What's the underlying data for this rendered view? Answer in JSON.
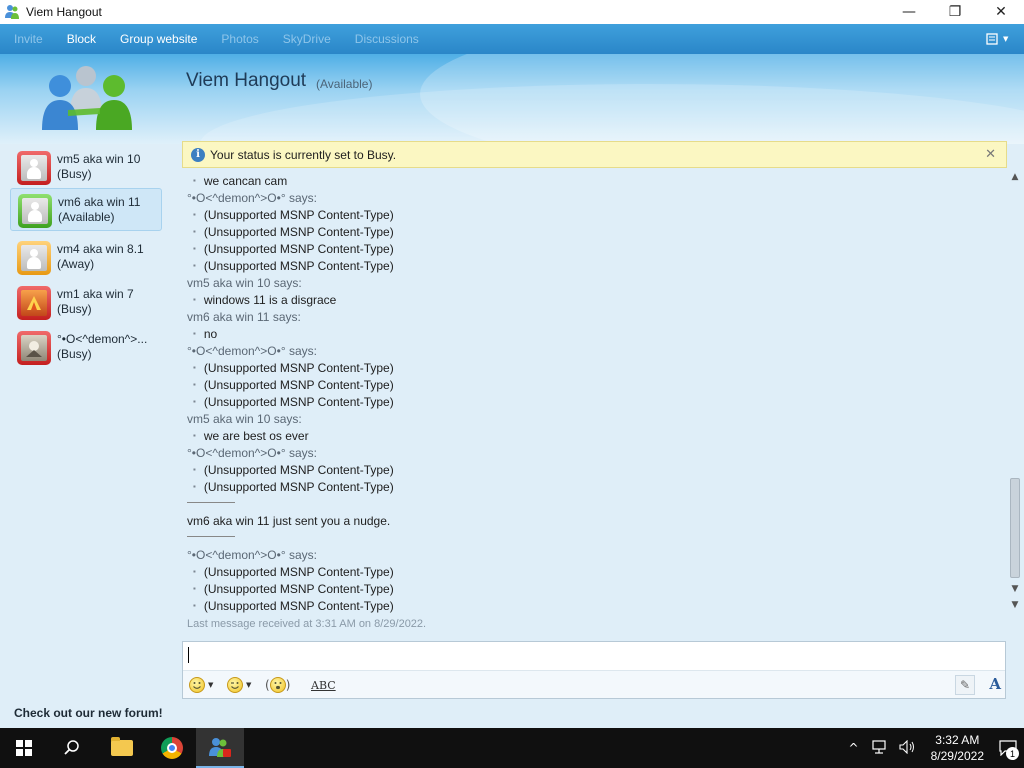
{
  "window": {
    "title": "Viem Hangout",
    "controls": {
      "minimize": "—",
      "maximize": "❐",
      "close": "✕"
    }
  },
  "menubar": {
    "items": [
      {
        "label": "Invite",
        "enabled": false
      },
      {
        "label": "Block",
        "enabled": true
      },
      {
        "label": "Group website",
        "enabled": true
      },
      {
        "label": "Photos",
        "enabled": false
      },
      {
        "label": "SkyDrive",
        "enabled": false
      },
      {
        "label": "Discussions",
        "enabled": false
      }
    ]
  },
  "conversation": {
    "title": "Viem Hangout",
    "status": "(Available)"
  },
  "sidebar": {
    "contacts": [
      {
        "name": "vm5 aka win 10",
        "status": "(Busy)",
        "status_key": "busy"
      },
      {
        "name": "vm6 aka win 11",
        "status": "(Available)",
        "status_key": "available"
      },
      {
        "name": "vm4 aka win 8.1",
        "status": "(Away)",
        "status_key": "away"
      },
      {
        "name": "vm1 aka win 7",
        "status": "(Busy)",
        "status_key": "busy"
      },
      {
        "name": "°•Ο<^demon^>...",
        "status": "(Busy)",
        "status_key": "busy"
      }
    ],
    "footer": "Check out our new forum!"
  },
  "notification": {
    "text": "Your status is currently set to Busy.",
    "icon": "info-icon"
  },
  "transcript": {
    "lines": [
      {
        "kind": "bullet",
        "text": "we cancan cam"
      },
      {
        "kind": "sender",
        "text": "°•Ο<^demon^>Ο•° says:"
      },
      {
        "kind": "bullet",
        "text": "(Unsupported MSNP Content-Type)"
      },
      {
        "kind": "bullet",
        "text": "(Unsupported MSNP Content-Type)"
      },
      {
        "kind": "bullet",
        "text": "(Unsupported MSNP Content-Type)"
      },
      {
        "kind": "bullet",
        "text": "(Unsupported MSNP Content-Type)"
      },
      {
        "kind": "sender",
        "text": "vm5 aka win 10 says:"
      },
      {
        "kind": "bullet",
        "text": "windows 11 is a disgrace"
      },
      {
        "kind": "sender",
        "text": "vm6 aka win 11 says:"
      },
      {
        "kind": "bullet",
        "text": "no"
      },
      {
        "kind": "sender",
        "text": "°•Ο<^demon^>Ο•° says:"
      },
      {
        "kind": "bullet",
        "text": "(Unsupported MSNP Content-Type)"
      },
      {
        "kind": "bullet",
        "text": "(Unsupported MSNP Content-Type)"
      },
      {
        "kind": "bullet",
        "text": "(Unsupported MSNP Content-Type)"
      },
      {
        "kind": "sender",
        "text": "vm5 aka win 10 says:"
      },
      {
        "kind": "bullet",
        "text": "we are best os ever"
      },
      {
        "kind": "sender",
        "text": "°•Ο<^demon^>Ο•° says:"
      },
      {
        "kind": "bullet",
        "text": "(Unsupported MSNP Content-Type)"
      },
      {
        "kind": "bullet",
        "text": "(Unsupported MSNP Content-Type)"
      }
    ],
    "nudge": "vm6 aka win 11 just sent you a nudge.",
    "after_nudge": [
      {
        "kind": "sender",
        "text": "°•Ο<^demon^>Ο•° says:"
      },
      {
        "kind": "bullet",
        "text": "(Unsupported MSNP Content-Type)"
      },
      {
        "kind": "bullet",
        "text": "(Unsupported MSNP Content-Type)"
      },
      {
        "kind": "bullet",
        "text": "(Unsupported MSNP Content-Type)"
      }
    ],
    "last_message": "Last message received at 3:31 AM on 8/29/2022."
  },
  "input": {
    "value": "",
    "toolbar": {
      "emoticon": "smiley-icon",
      "wink": "wink-icon",
      "nudge": "nudge-icon",
      "spellcheck_label": "ABC",
      "font_label": "A"
    }
  },
  "taskbar": {
    "time": "3:32 AM",
    "date": "8/29/2022",
    "notification_count": "1",
    "tray": {
      "chevron": "^",
      "network": "network-icon",
      "volume": "volume-icon"
    }
  },
  "colors": {
    "menubar": "#2a86c8",
    "busy": "#c41f1f",
    "available": "#3fa11f",
    "away": "#e89a14",
    "notification_bg": "#fbf7c2"
  }
}
